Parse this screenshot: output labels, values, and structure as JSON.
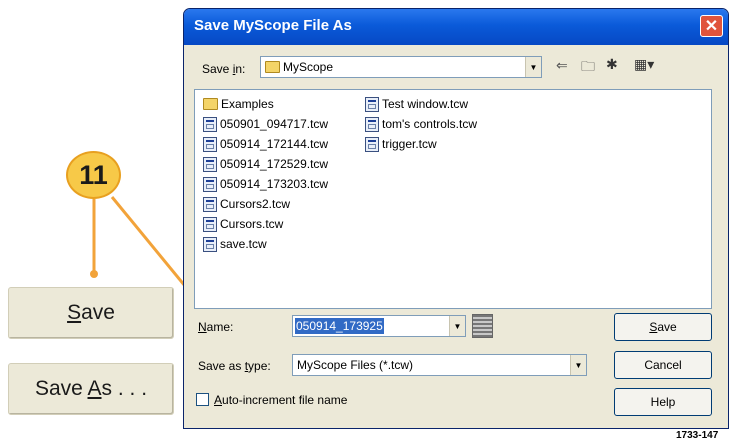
{
  "dialog": {
    "title": "Save MyScope File As",
    "close_glyph": "✕",
    "save_in_label": "Save in:",
    "save_in_value": "MyScope",
    "files_col1": [
      "Examples",
      "050901_094717.tcw",
      "050914_172144.tcw",
      "050914_172529.tcw",
      "050914_173203.tcw",
      "Cursors2.tcw",
      "Cursors.tcw",
      "save.tcw"
    ],
    "files_col2": [
      "Test window.tcw",
      "tom's controls.tcw",
      "trigger.tcw"
    ],
    "name_label": "Name:",
    "name_value": "050914_173925",
    "type_label": "Save as type:",
    "type_value": "MyScope Files (*.tcw)",
    "auto_increment_label": "Auto-increment file name",
    "save_button": "Save",
    "cancel_button": "Cancel",
    "help_button": "Help"
  },
  "side": {
    "save_button": "Save",
    "save_as_button": "Save As . . ."
  },
  "callout_number": "11",
  "figure_number": "1733-147",
  "colors": {
    "titlebar": "#0a5ad9",
    "callout_fill": "#f7c948",
    "callout_line": "#f2a33a",
    "selection": "#316ac5"
  }
}
